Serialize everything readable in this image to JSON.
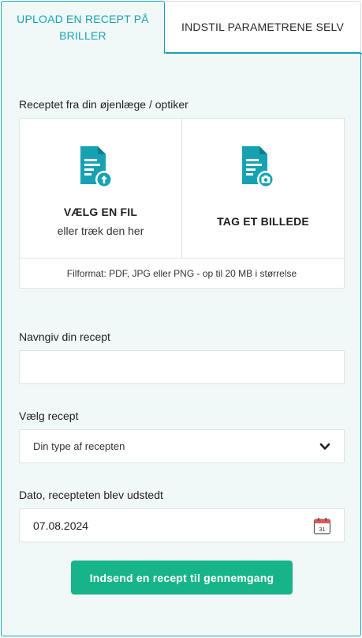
{
  "tabs": [
    {
      "label": "UPLOAD EN RECEPT PÅ BRILLER",
      "active": true
    },
    {
      "label": "INDSTIL PARAMETRENE SELV",
      "active": false
    }
  ],
  "upload": {
    "section_label": "Receptet fra din øjenlæge / optiker",
    "file_title": "VÆLG EN FIL",
    "file_subtitle": "eller træk den her",
    "photo_title": "TAG ET BILLEDE",
    "format_note": "Filformat: PDF, JPG eller PNG - op til 20 MB i størrelse"
  },
  "name_field": {
    "label": "Navngiv din recept",
    "value": ""
  },
  "type_select": {
    "label": "Vælg recept",
    "selected": "Din type af recepten"
  },
  "date_field": {
    "label": "Dato, recepteten blev udstedt",
    "value": "07.08.2024",
    "calendar_day": "31"
  },
  "submit_label": "Indsend en recept til gennemgang",
  "colors": {
    "accent": "#14a3b0",
    "icon": "#17a2b3",
    "submit": "#17b489",
    "panel_bg": "#f1f8f8"
  }
}
